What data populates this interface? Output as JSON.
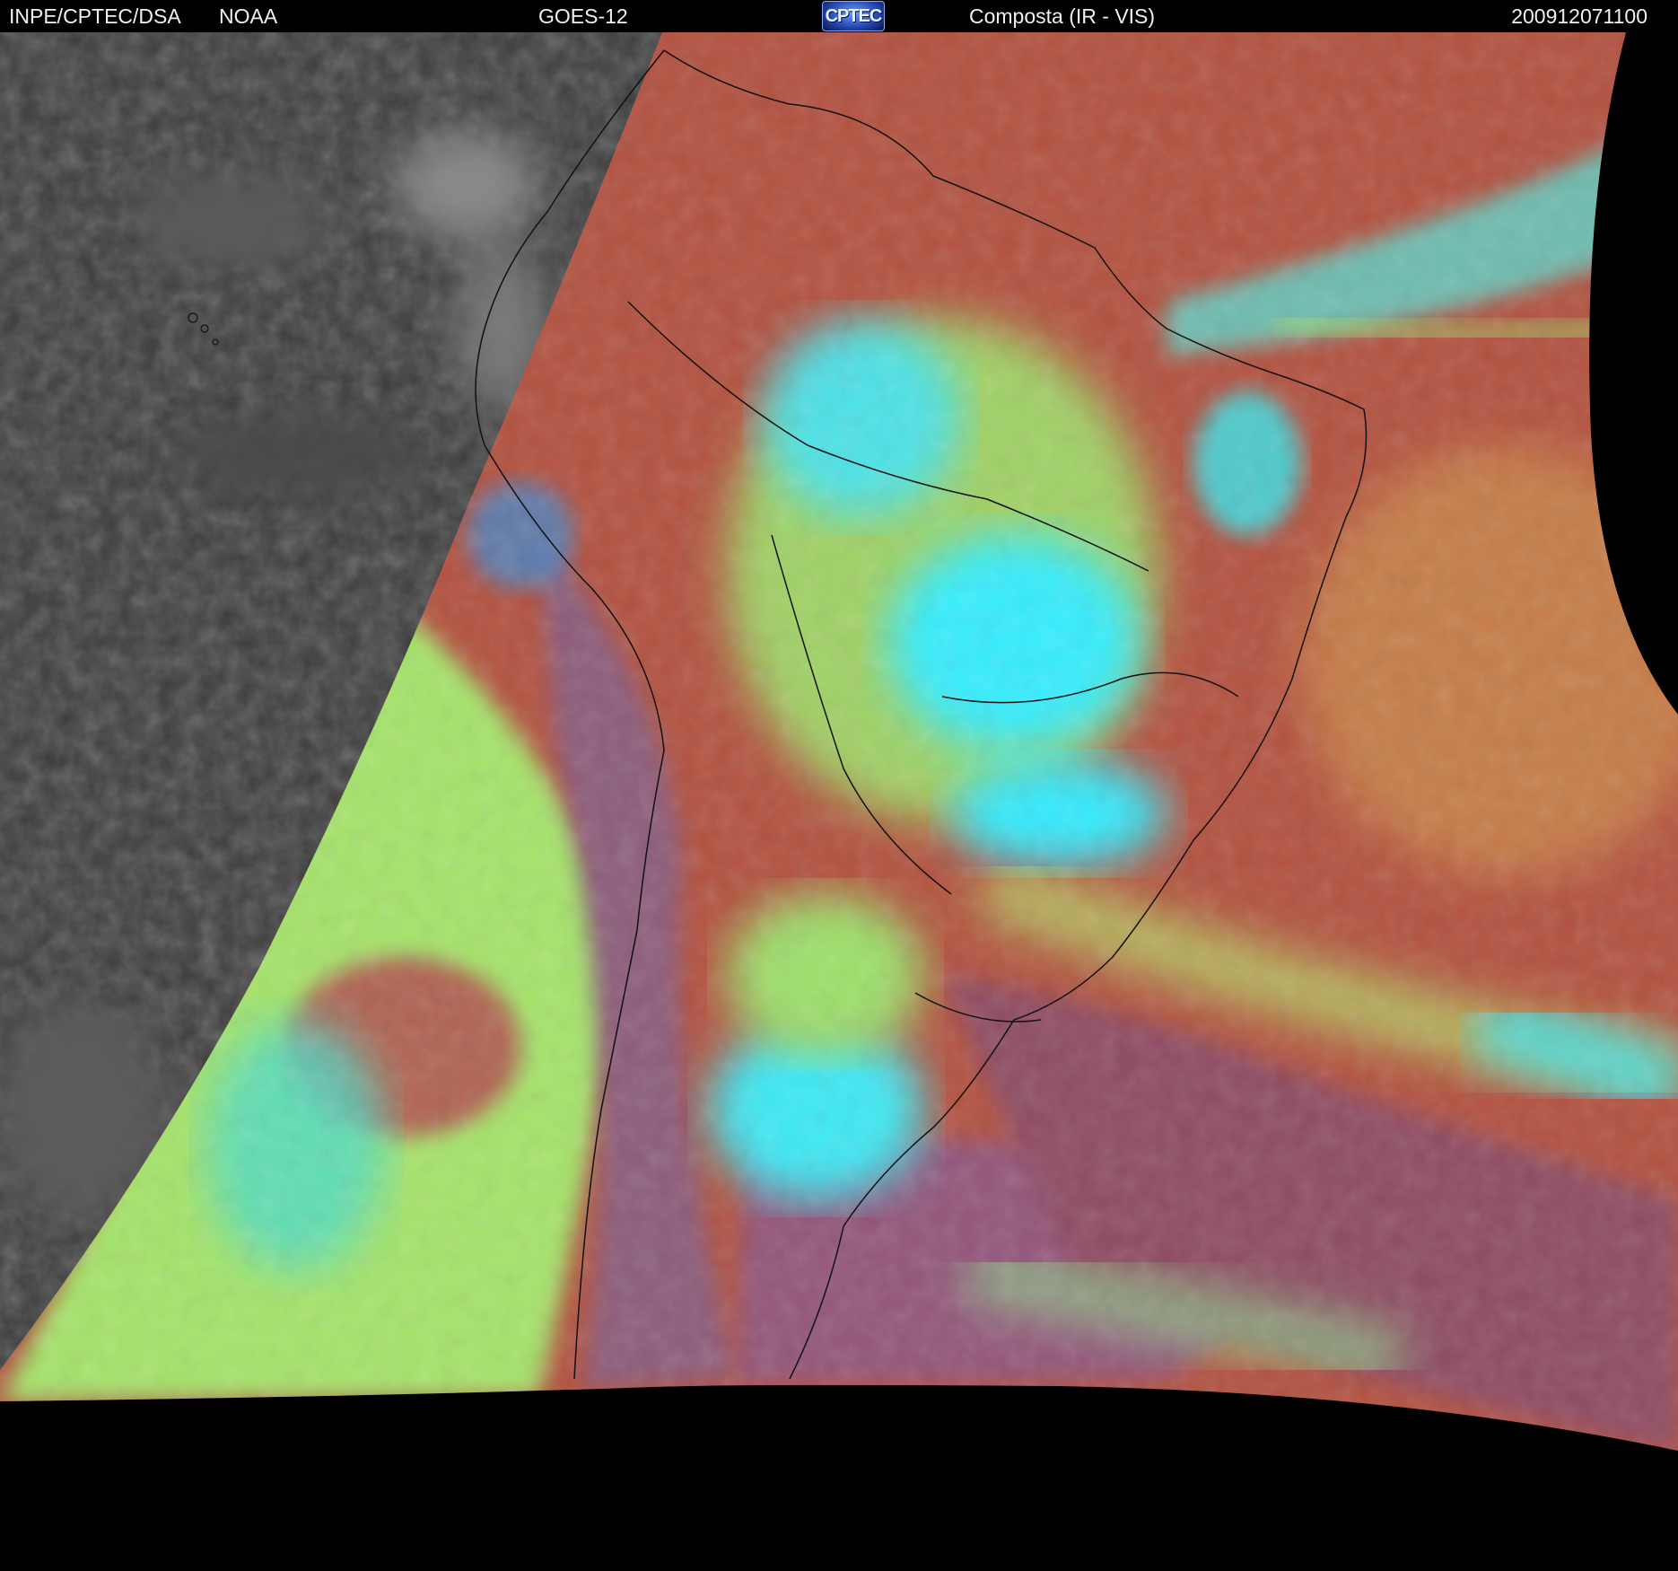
{
  "header": {
    "organization": "INPE/CPTEC/DSA",
    "agency": "NOAA",
    "satellite": "GOES-12",
    "logo_text": "CPTEC",
    "product": "Composta (IR - VIS)",
    "timestamp": "200912071100"
  },
  "colors": {
    "background": "#000000",
    "night_side": "#3a3a3a",
    "clear_warm": "#b5503c",
    "low_cloud": "#a6e86a",
    "high_cloud": "#2ef0ff",
    "mid_cloud": "#8f5a7e",
    "coastline": "#111111"
  }
}
